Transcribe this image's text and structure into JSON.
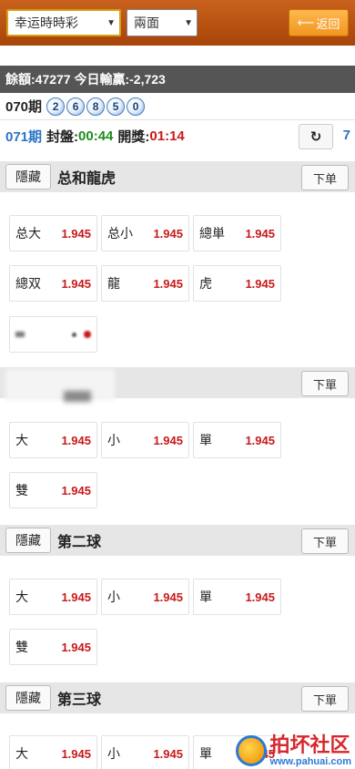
{
  "header": {
    "game_select": "幸运時時彩",
    "mode_select": "兩面",
    "back_label": "返回"
  },
  "account": {
    "balance_text": "餘額:47277 今日輸贏:-2,723"
  },
  "previous": {
    "label": "070期",
    "balls": [
      "2",
      "6",
      "8",
      "5",
      "0"
    ]
  },
  "current": {
    "issue": "071期",
    "close_label": "封盤:",
    "close_time": "00:44",
    "draw_label": "開獎:",
    "draw_time": "01:14",
    "counter": "7"
  },
  "sections": [
    {
      "hide_label": "隱藏",
      "title": "总和龍虎",
      "order_label": "下单",
      "cells": [
        {
          "name": "总大",
          "odd": "1.945"
        },
        {
          "name": "总小",
          "odd": "1.945"
        },
        {
          "name": "總単",
          "odd": "1.945"
        },
        {
          "name": "總双",
          "odd": "1.945"
        },
        {
          "name": "龍",
          "odd": "1.945"
        },
        {
          "name": "虎",
          "odd": "1.945"
        }
      ]
    },
    {
      "hide_label": "",
      "title": "",
      "order_label": "下單",
      "cells": [
        {
          "name": "大",
          "odd": "1.945"
        },
        {
          "name": "小",
          "odd": "1.945"
        },
        {
          "name": "單",
          "odd": "1.945"
        },
        {
          "name": "雙",
          "odd": "1.945"
        }
      ]
    },
    {
      "hide_label": "隱藏",
      "title": "第二球",
      "order_label": "下單",
      "cells": [
        {
          "name": "大",
          "odd": "1.945"
        },
        {
          "name": "小",
          "odd": "1.945"
        },
        {
          "name": "單",
          "odd": "1.945"
        },
        {
          "name": "雙",
          "odd": "1.945"
        }
      ]
    },
    {
      "hide_label": "隱藏",
      "title": "第三球",
      "order_label": "下單",
      "cells": [
        {
          "name": "大",
          "odd": "1.945"
        },
        {
          "name": "小",
          "odd": "1.945"
        },
        {
          "name": "單",
          "odd": "945"
        }
      ]
    }
  ],
  "watermark": {
    "title": "拍坏社区",
    "url": "www.pahuai.com"
  }
}
